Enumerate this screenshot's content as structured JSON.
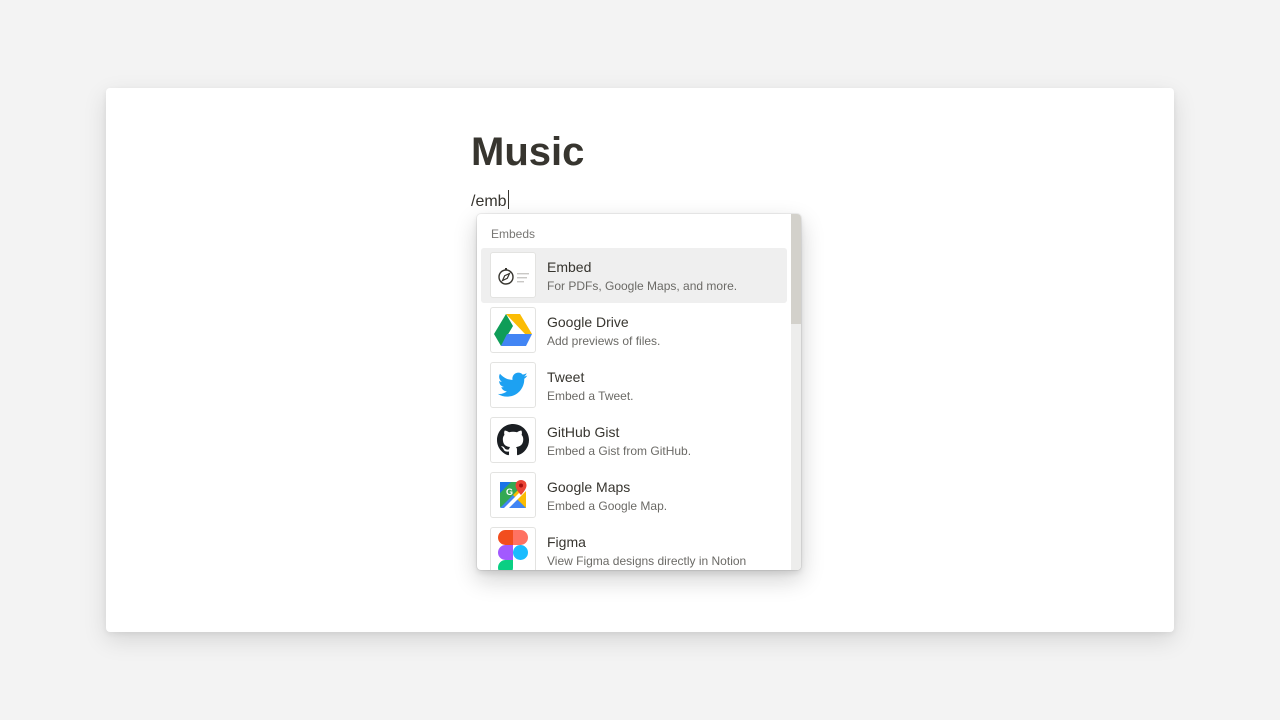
{
  "page": {
    "title": "Music",
    "editor_text": "/emb"
  },
  "slash_menu": {
    "section_label": "Embeds",
    "items": [
      {
        "title": "Embed",
        "description": "For PDFs, Google Maps, and more.",
        "icon": "embed-compass-icon",
        "selected": true
      },
      {
        "title": "Google Drive",
        "description": "Add previews of files.",
        "icon": "google-drive-icon",
        "selected": false
      },
      {
        "title": "Tweet",
        "description": "Embed a Tweet.",
        "icon": "twitter-bird-icon",
        "selected": false
      },
      {
        "title": "GitHub Gist",
        "description": "Embed a Gist from GitHub.",
        "icon": "github-octocat-icon",
        "selected": false
      },
      {
        "title": "Google Maps",
        "description": "Embed a Google Map.",
        "icon": "google-maps-icon",
        "selected": false
      },
      {
        "title": "Figma",
        "description": "View Figma designs directly in Notion",
        "icon": "figma-icon",
        "selected": false
      }
    ]
  },
  "colors": {
    "text": "#37352f",
    "secondary_text": "#6b6a66",
    "selected_row": "#efefef",
    "background": "#f3f3f3",
    "twitter_blue": "#1da1f2"
  }
}
